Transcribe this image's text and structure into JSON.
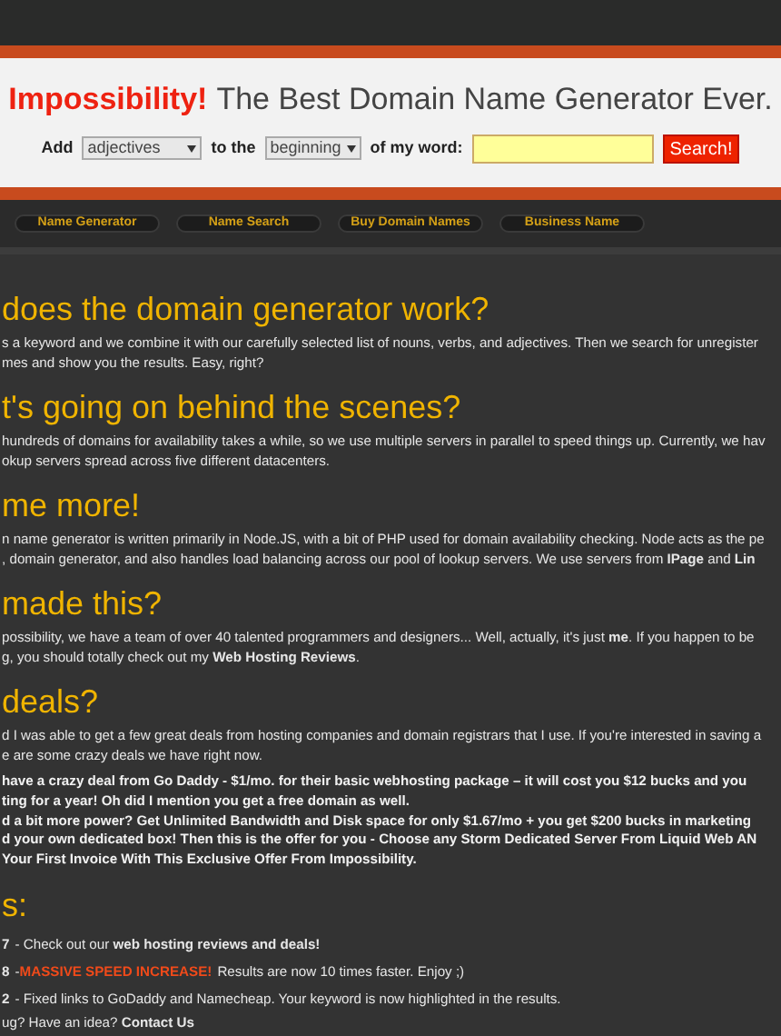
{
  "header": {
    "brand": "Impossibility!",
    "tagline": "The Best Domain Name Generator Ever.",
    "form": {
      "add_label": "Add",
      "word_type": "adjectives",
      "position_label": "to the",
      "position": "beginning",
      "word_label": "of my word:",
      "button": "Search!"
    }
  },
  "nav": [
    {
      "label": "Name Generator"
    },
    {
      "label": "Name Search"
    },
    {
      "label": "Buy Domain Names"
    },
    {
      "label": "Business Name"
    }
  ],
  "sections": [
    {
      "heading": "does the domain generator work?",
      "lines": [
        "s a keyword and we combine it with our carefully selected list of nouns, verbs, and adjectives. Then we search for unregister",
        "mes and show you the results. Easy, right?"
      ]
    },
    {
      "heading": "t's going on behind the scenes?",
      "lines": [
        "hundreds of domains for availability takes a while, so we use multiple servers in parallel to speed things up. Currently, we hav",
        "okup servers spread across five different datacenters."
      ]
    },
    {
      "heading": "me more!",
      "lines": [
        "n name generator is written primarily in Node.JS, with a bit of PHP used for domain availability checking. Node acts as the pe",
        ", domain generator, and also handles load balancing across our pool of lookup servers. We use servers from **IPage** and **Lin**"
      ]
    },
    {
      "heading": " made this?",
      "lines": [
        "possibility, we have a team of over 40 talented programmers and designers... Well, actually, it's just **me**. If you happen to be",
        "g, you should totally check out my **Web Hosting Reviews**."
      ]
    },
    {
      "heading": "deals?",
      "lines": [
        "d I was able to get a few great deals from hosting companies and domain registrars that I use. If you're interested in saving a",
        "e are some crazy deals we have right now."
      ],
      "bold_lines": [
        "have a crazy deal from Go Daddy - $1/mo. for their basic webhosting package – it will cost you $12 bucks and you",
        "ting for a year! Oh did I mention you get a free domain as well.",
        "d a bit more power? Get Unlimited Bandwidth and Disk space for only $1.67/mo + you get $200 bucks in marketing",
        "d your own dedicated box! Then this is the offer for you - Choose any Storm Dedicated Server From Liquid Web AN",
        "Your First Invoice With This Exclusive Offer From Impossibility."
      ]
    },
    {
      "heading": "s:",
      "updates": [
        {
          "date": "7",
          "text": "- Check out our **web hosting reviews and deals!**"
        },
        {
          "date": "8",
          "text": "- ",
          "alert": "MASSIVE SPEED INCREASE!",
          "after": "Results are now 10 times faster. Enjoy ;)"
        },
        {
          "date": "2",
          "text": "- Fixed links to GoDaddy and Namecheap. Your keyword is now highlighted in the results."
        }
      ],
      "footer_line": "ug? Have an idea? **Contact Us**"
    }
  ]
}
